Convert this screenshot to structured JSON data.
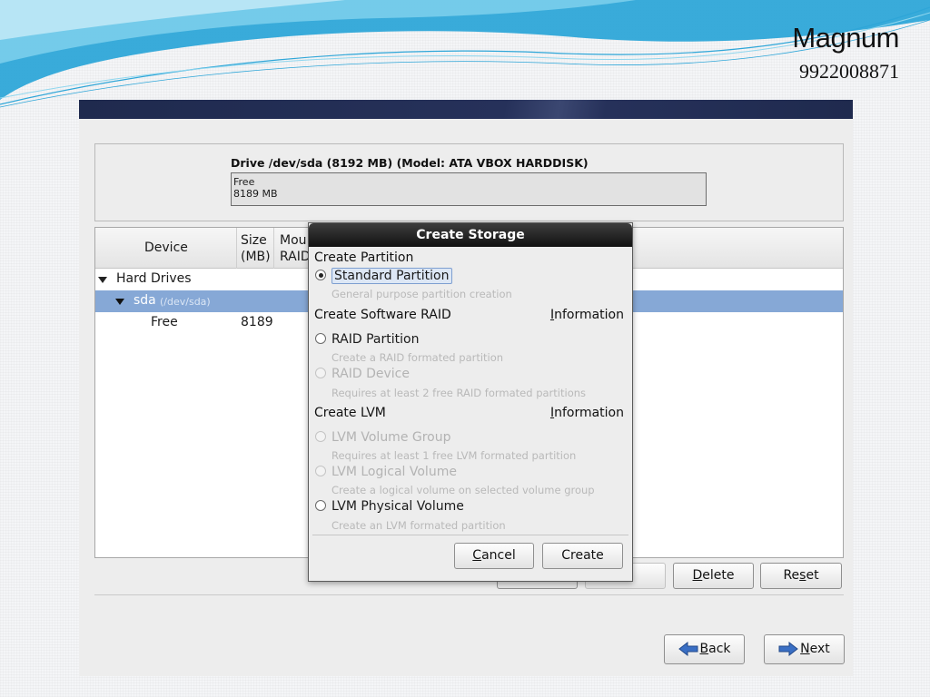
{
  "slide": {
    "brand_name": "Magnum",
    "brand_phone": "9922008871",
    "wave_color": "#2ea6d8"
  },
  "drive": {
    "title": "Drive /dev/sda (8192 MB) (Model: ATA VBOX HARDDISK)",
    "segment_label": "Free",
    "segment_size": "8189 MB"
  },
  "tree": {
    "columns": {
      "device": "Device",
      "size_line1": "Size",
      "size_line2": "(MB)",
      "mount_line1": "Mou",
      "mount_line2": "RAID"
    },
    "rows": {
      "hard_drives": "Hard Drives",
      "sda_name": "sda",
      "sda_path": "(/dev/sda)",
      "free_name": "Free",
      "free_size": "8189"
    },
    "selection_color": "#86a8d6"
  },
  "buttons": {
    "delete": {
      "pre": "",
      "mnemonic": "D",
      "post": "elete"
    },
    "reset": {
      "pre": "Re",
      "mnemonic": "s",
      "post": "et"
    },
    "back": {
      "pre": "",
      "mnemonic": "B",
      "post": "ack"
    },
    "next": {
      "pre": "",
      "mnemonic": "N",
      "post": "ext"
    }
  },
  "dialog": {
    "title": "Create Storage",
    "sections": {
      "partition": "Create Partition",
      "raid": "Create Software RAID",
      "lvm": "Create LVM"
    },
    "info_link": {
      "mnemonic": "I",
      "rest": "nformation"
    },
    "options": {
      "standard": {
        "label": "Standard Partition",
        "desc": "General purpose partition creation"
      },
      "raid_partition": {
        "label": "RAID Partition",
        "desc": "Create a RAID formated partition"
      },
      "raid_device": {
        "label": "RAID Device",
        "desc": "Requires at least 2 free RAID formated partitions"
      },
      "lvm_group": {
        "label": "LVM Volume Group",
        "desc": "Requires at least 1 free LVM formated partition"
      },
      "lvm_logical": {
        "label": "LVM Logical Volume",
        "desc": "Create a logical volume on selected volume group"
      },
      "lvm_physical": {
        "label": "LVM Physical Volume",
        "desc": "Create an LVM formated partition"
      }
    },
    "cancel": {
      "mnemonic": "C",
      "rest": "ancel"
    },
    "create": "Create"
  },
  "icons": {
    "back": "left-arrow-icon",
    "next": "right-arrow-icon",
    "arrow_color": "#3a6fc4"
  }
}
